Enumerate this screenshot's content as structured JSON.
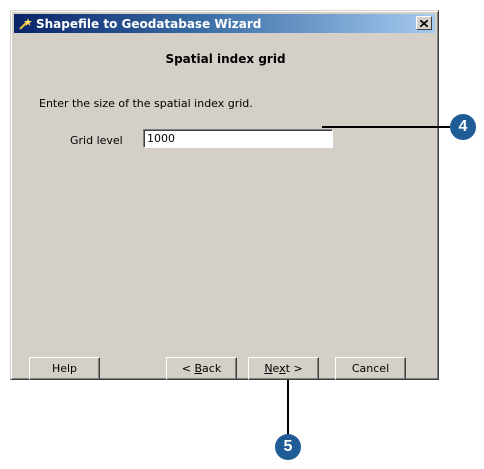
{
  "window": {
    "title": "Shapefile to Geodatabase  Wizard",
    "title_icon": "wand-icon",
    "close_icon": "close-icon"
  },
  "page": {
    "heading": "Spatial index grid",
    "instruction": "Enter the size of the spatial index grid.",
    "grid_label": "Grid level",
    "grid_value": "1000"
  },
  "buttons": {
    "help": "Help",
    "back_prefix": "< ",
    "back_mnemonic": "B",
    "back_rest": "ack",
    "next_mnemonic": "N",
    "next_mid": "e",
    "next_x": "x",
    "next_rest": "t >",
    "cancel": "Cancel"
  },
  "callouts": {
    "step_4": "4",
    "step_5": "5"
  },
  "colors": {
    "callout": "#1f5c96",
    "title_bar": "#0a246a",
    "dialog": "#d4d0c8"
  }
}
